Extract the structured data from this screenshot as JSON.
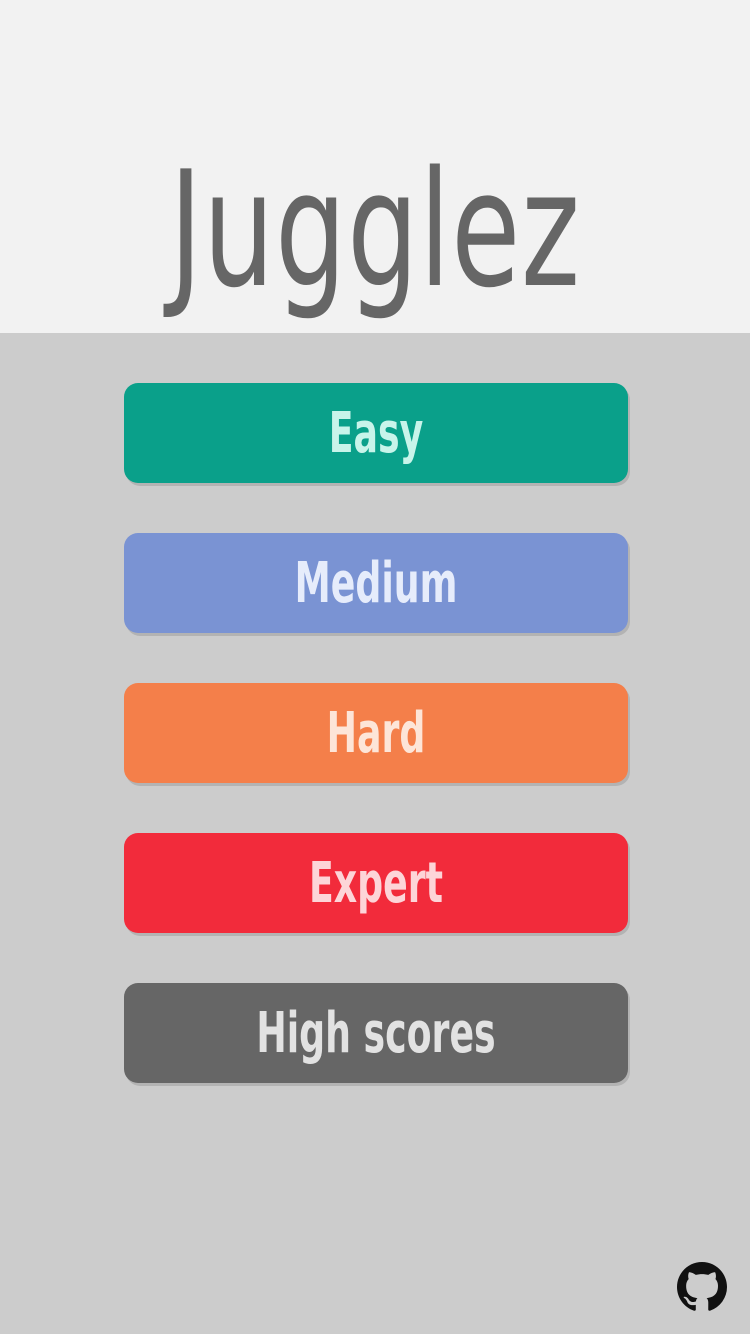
{
  "app": {
    "title": "Jugglez"
  },
  "menu": {
    "buttons": [
      {
        "id": "easy",
        "label": "Easy",
        "bg": "#0aa08a",
        "fg": "#c8f4ea"
      },
      {
        "id": "medium",
        "label": "Medium",
        "bg": "#7a93d3",
        "fg": "#e6ecfb"
      },
      {
        "id": "hard",
        "label": "Hard",
        "bg": "#f47f4a",
        "fg": "#fde5d8"
      },
      {
        "id": "expert",
        "label": "Expert",
        "bg": "#f22b3b",
        "fg": "#fdd5d8"
      },
      {
        "id": "high-scores",
        "label": "High scores",
        "bg": "#666666",
        "fg": "#e2e2e2"
      }
    ]
  },
  "footer": {
    "icon": "github-icon"
  },
  "colors": {
    "header_bg": "#f2f2f2",
    "body_bg": "#cccccc",
    "title": "#666666"
  }
}
